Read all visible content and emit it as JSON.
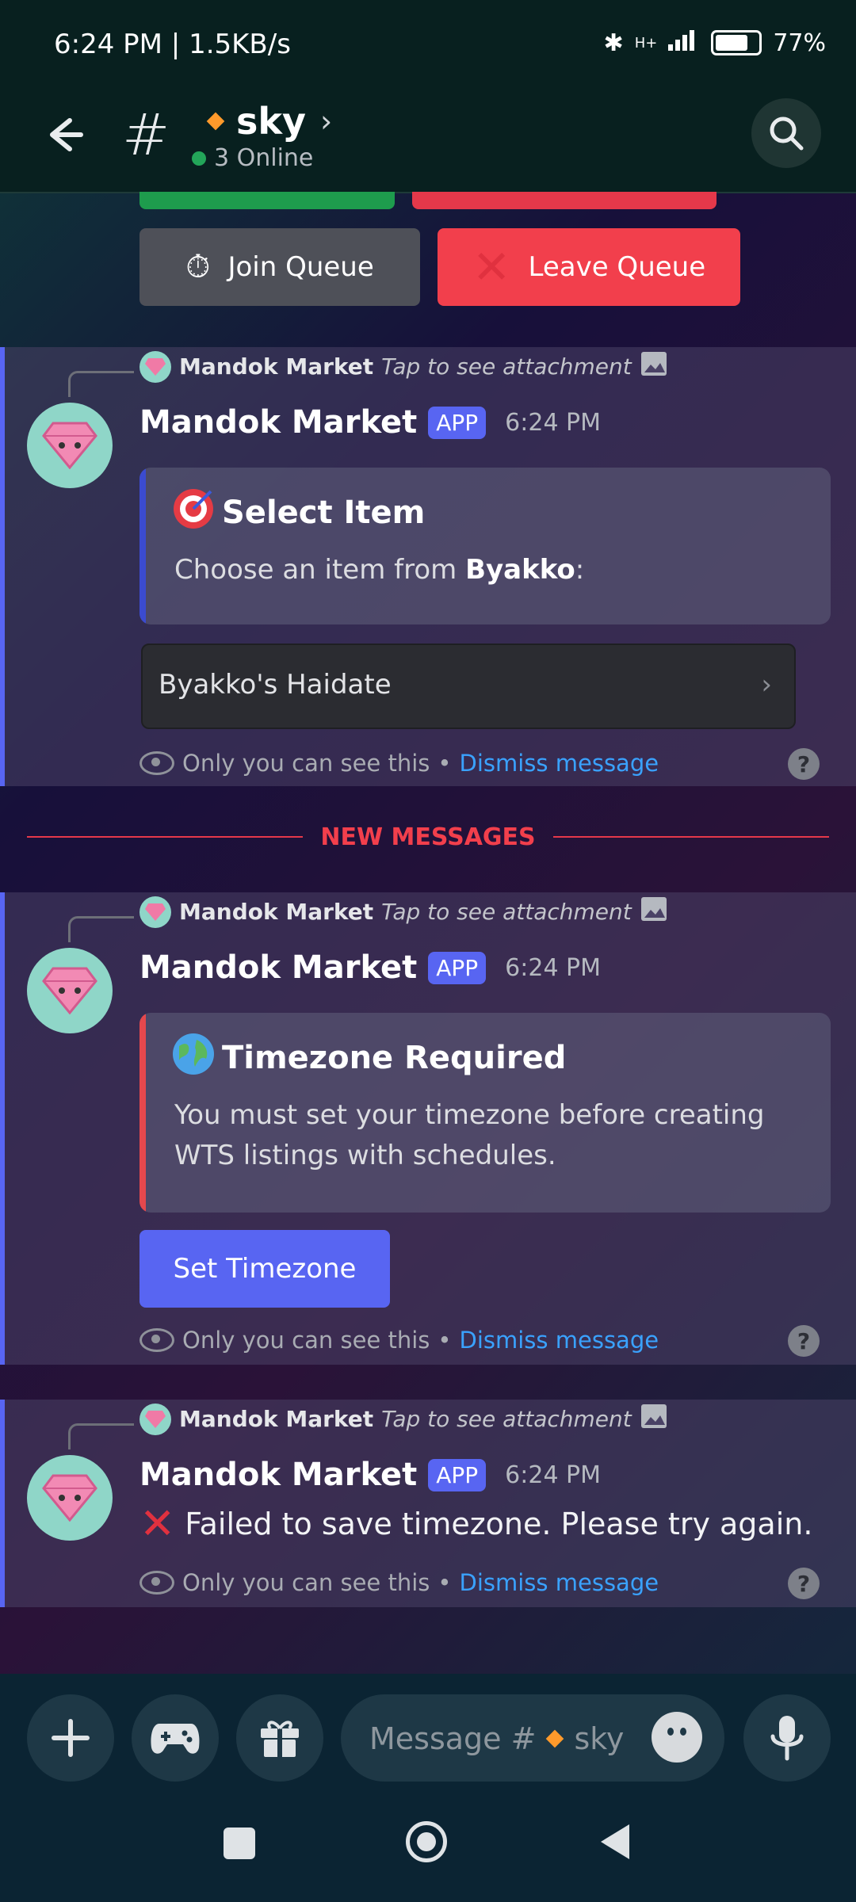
{
  "status": {
    "time": "6:24 PM | 1.5KB/s",
    "battery": "77%",
    "network": "H+"
  },
  "header": {
    "channel": "sky",
    "online": "3 Online"
  },
  "queue": {
    "join": "Join Queue",
    "leave": "Leave Queue"
  },
  "messages": [
    {
      "reply_name": "Mandok Market",
      "reply_note": "Tap to see attachment",
      "author": "Mandok Market",
      "badge": "APP",
      "time": "6:24 PM",
      "embed_title": "Select Item",
      "embed_desc_prefix": "Choose an item from ",
      "embed_desc_bold": "Byakko",
      "embed_desc_suffix": ":",
      "select_value": "Byakko's Haidate",
      "ephemeral": "Only you can see this",
      "dismiss": "Dismiss message"
    },
    {
      "reply_name": "Mandok Market",
      "reply_note": "Tap to see attachment",
      "author": "Mandok Market",
      "badge": "APP",
      "time": "6:24 PM",
      "embed_title": "Timezone Required",
      "embed_desc": "You must set your timezone before creating WTS listings with schedules.",
      "button": "Set Timezone",
      "ephemeral": "Only you can see this",
      "dismiss": "Dismiss message"
    },
    {
      "reply_name": "Mandok Market",
      "reply_note": "Tap to see attachment",
      "author": "Mandok Market",
      "badge": "APP",
      "time": "6:24 PM",
      "text": "Failed to save timezone. Please try again.",
      "ephemeral": "Only you can see this",
      "dismiss": "Dismiss message"
    }
  ],
  "divider": "NEW MESSAGES",
  "composer": {
    "placeholder_prefix": "Message #",
    "placeholder_channel": "sky"
  },
  "colors": {
    "accent": "#5865f2",
    "danger": "#f23f4c",
    "link": "#3aa2ff",
    "online": "#23a559"
  }
}
